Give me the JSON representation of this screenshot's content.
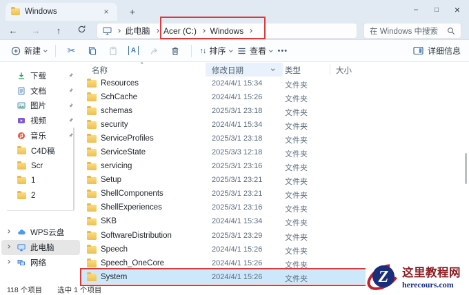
{
  "window": {
    "tab_title": "Windows",
    "tab_close_glyph": "×",
    "new_tab_glyph": "+",
    "minimize_glyph": "–",
    "maximize_glyph": "□",
    "close_glyph": "×"
  },
  "address_bar": {
    "back_glyph": "←",
    "forward_glyph": "→",
    "up_glyph": "↑",
    "breadcrumb": {
      "segments": [
        "此电脑",
        "Acer (C:)",
        "Windows"
      ]
    },
    "search_placeholder": "在 Windows 中搜索"
  },
  "toolbar": {
    "new_label": "新建",
    "cut_glyph": "✂",
    "rename_glyph": "A",
    "sort_glyph": "↑↓",
    "sort_label": "排序",
    "view_label": "查看",
    "more_glyph": "•••",
    "details_label": "详细信息"
  },
  "sidebar": {
    "items": [
      {
        "label": "下载",
        "pinned": true
      },
      {
        "label": "文档",
        "pinned": true
      },
      {
        "label": "图片",
        "pinned": true
      },
      {
        "label": "视频",
        "pinned": true
      },
      {
        "label": "音乐",
        "pinned": true
      },
      {
        "label": "C4D稿",
        "pinned": false
      },
      {
        "label": "Scr",
        "pinned": false
      },
      {
        "label": "1",
        "pinned": false
      },
      {
        "label": "2",
        "pinned": false
      },
      {
        "label": "WPS云盘",
        "pinned": false
      },
      {
        "label": "此电脑",
        "pinned": false,
        "selected": true
      },
      {
        "label": "网络",
        "pinned": false
      }
    ]
  },
  "file_list": {
    "columns": [
      "名称",
      "修改日期",
      "类型",
      "大小"
    ],
    "rows": [
      {
        "name": "Resources",
        "date": "2024/4/1 15:34",
        "type": "文件夹"
      },
      {
        "name": "SchCache",
        "date": "2024/4/1 15:26",
        "type": "文件夹"
      },
      {
        "name": "schemas",
        "date": "2025/3/1 23:18",
        "type": "文件夹"
      },
      {
        "name": "security",
        "date": "2024/4/1 15:34",
        "type": "文件夹"
      },
      {
        "name": "ServiceProfiles",
        "date": "2025/3/1 23:18",
        "type": "文件夹"
      },
      {
        "name": "ServiceState",
        "date": "2025/3/3 12:18",
        "type": "文件夹"
      },
      {
        "name": "servicing",
        "date": "2025/3/1 23:16",
        "type": "文件夹"
      },
      {
        "name": "Setup",
        "date": "2025/3/1 23:21",
        "type": "文件夹"
      },
      {
        "name": "ShellComponents",
        "date": "2025/3/1 23:21",
        "type": "文件夹"
      },
      {
        "name": "ShellExperiences",
        "date": "2025/3/1 23:16",
        "type": "文件夹"
      },
      {
        "name": "SKB",
        "date": "2024/4/1 15:34",
        "type": "文件夹"
      },
      {
        "name": "SoftwareDistribution",
        "date": "2025/3/1 23:29",
        "type": "文件夹"
      },
      {
        "name": "Speech",
        "date": "2024/4/1 15:26",
        "type": "文件夹"
      },
      {
        "name": "Speech_OneCore",
        "date": "2024/4/1 15:26",
        "type": "文件夹"
      },
      {
        "name": "System",
        "date": "2024/4/1 15:26",
        "type": "文件夹",
        "selected": true
      }
    ]
  },
  "status_bar": {
    "items_count": "118 个项目",
    "selected_count": "选中 1 个项目"
  },
  "watermark": {
    "logo_letter": "Z",
    "site_name": "这里教程网",
    "site_url": "herecours.com"
  },
  "colors": {
    "chrome_background": "#e1eaf3",
    "selection_blue": "#cde8fb",
    "annotation_red": "#d93a3c",
    "accent_blue": "#3a70b5",
    "folder_yellow": "#f0bf4e"
  }
}
